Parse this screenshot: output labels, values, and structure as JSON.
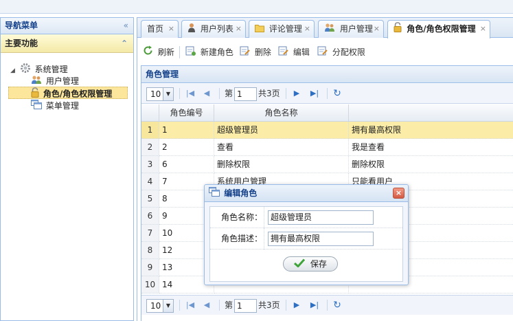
{
  "nav": {
    "header": "导航菜单",
    "collapse_glyph": "«",
    "section": "主要功能",
    "section_toggle_glyph": "⌃",
    "tree": {
      "root_label": "系统管理",
      "items": [
        {
          "label": "用户管理",
          "icon": "users-icon"
        },
        {
          "label": "角色/角色权限管理",
          "icon": "lock-icon",
          "selected": true
        },
        {
          "label": "菜单管理",
          "icon": "window-icon"
        }
      ]
    }
  },
  "tabs": [
    {
      "label": "首页",
      "close": "×"
    },
    {
      "label": "用户列表",
      "close": "×",
      "icon": "user-icon"
    },
    {
      "label": "评论管理",
      "close": "×",
      "icon": "folder-icon"
    },
    {
      "label": "用户管理",
      "close": "×",
      "icon": "users-icon"
    },
    {
      "label": "角色/角色权限管理",
      "close": "×",
      "icon": "lock-icon",
      "active": true
    }
  ],
  "toolbar": {
    "refresh": "刷新",
    "create_role": "新建角色",
    "delete": "删除",
    "edit": "编辑",
    "assign_permission": "分配权限"
  },
  "panel": {
    "title": "角色管理"
  },
  "pager": {
    "page_size": "10",
    "page_label": "第",
    "page_value": "1",
    "total_label": "共3页",
    "dropdown_glyph": "▼",
    "first_glyph": "|◀",
    "prev_glyph": "◀",
    "next_glyph": "▶",
    "last_glyph": "▶|",
    "reload_glyph": "↻"
  },
  "grid": {
    "columns": [
      "角色编号",
      "角色名称",
      ""
    ],
    "rows": [
      {
        "n": "1",
        "id": "1",
        "name": "超级管理员",
        "desc": "拥有最高权限",
        "selected": true
      },
      {
        "n": "2",
        "id": "2",
        "name": "查看",
        "desc": "我是查看"
      },
      {
        "n": "3",
        "id": "6",
        "name": "删除权限",
        "desc": "删除权限"
      },
      {
        "n": "4",
        "id": "7",
        "name": "系统用户管理",
        "desc": "只能看用户"
      },
      {
        "n": "5",
        "id": "8",
        "name": "",
        "desc": ""
      },
      {
        "n": "6",
        "id": "9",
        "name": "",
        "desc": ""
      },
      {
        "n": "7",
        "id": "10",
        "name": "",
        "desc": ""
      },
      {
        "n": "8",
        "id": "12",
        "name": "",
        "desc": ""
      },
      {
        "n": "9",
        "id": "13",
        "name": "",
        "desc": ""
      },
      {
        "n": "10",
        "id": "14",
        "name": "",
        "desc": ""
      }
    ]
  },
  "dialog": {
    "title": "编辑角色",
    "close_glyph": "×",
    "name_label": "角色名称：",
    "name_value": "超级管理员",
    "desc_label": "角色描述：",
    "desc_value": "拥有最高权限",
    "save_label": "保存"
  },
  "colors": {
    "accent_blue": "#99bbe8",
    "title_blue": "#15428b",
    "selected_row": "#fbeda8"
  }
}
